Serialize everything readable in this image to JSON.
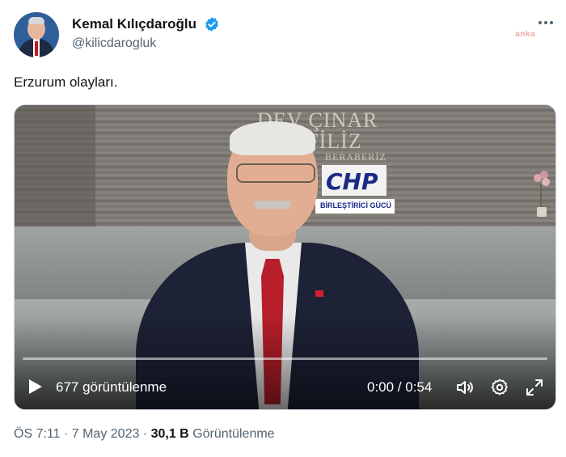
{
  "author": {
    "name": "Kemal Kılıçdaroğlu",
    "handle": "@kilicdarogluk",
    "verified": true
  },
  "watermark": "anka",
  "tweet": {
    "text": "Erzurum olayları."
  },
  "video": {
    "backdrop_sign": {
      "line1": "DEV ÇINAR",
      "line2": "İ FİLİZ",
      "line3": "BERABERİZ",
      "logo": "CHP",
      "banner": "BİRLEŞTİRİCİ GÜCÜ"
    },
    "views_label": "677 görüntülenme",
    "time_label": "0:00 / 0:54",
    "progress": 0
  },
  "meta": {
    "time": "ÖS 7:11",
    "date": "7 May 2023",
    "separator": "·",
    "views_count": "30,1 B",
    "views_word": "Görüntülenme"
  },
  "colors": {
    "primary_text": "#0f1419",
    "secondary_text": "#536471",
    "verified_blue": "#1d9bf0"
  }
}
